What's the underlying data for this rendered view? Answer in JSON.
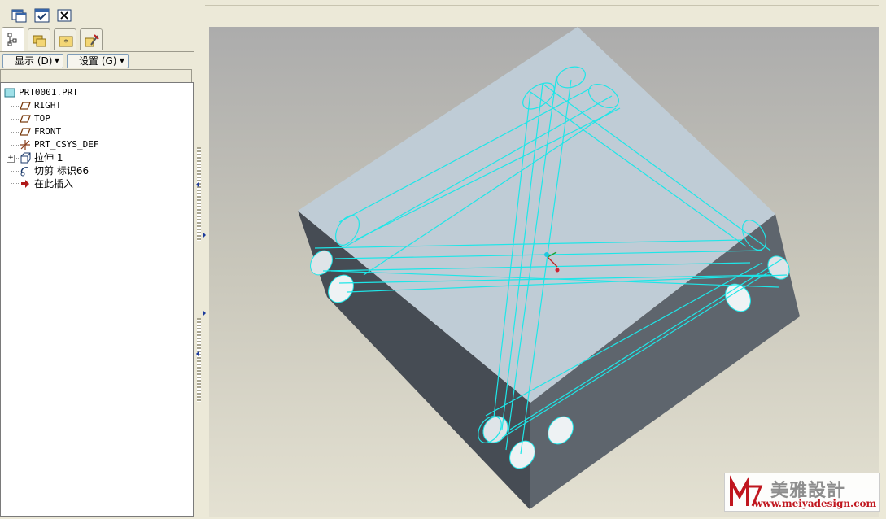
{
  "toolbar": {
    "buttons": [
      {
        "icon": "window-icon"
      },
      {
        "icon": "activate-window-icon"
      },
      {
        "icon": "close-window-icon"
      }
    ]
  },
  "tabs": [
    {
      "name": "model-tree-tab",
      "icon": "tree-icon",
      "active": true
    },
    {
      "name": "folder-browser-tab",
      "icon": "folders-icon",
      "active": false
    },
    {
      "name": "favorites-tab",
      "icon": "star-folder-icon",
      "active": false
    },
    {
      "name": "connections-tab",
      "icon": "tools-icon",
      "active": false
    }
  ],
  "dropdowns": {
    "display_label": "显示 (D)",
    "settings_label": "设置 (G)"
  },
  "tree": {
    "root": "PRT0001.PRT",
    "items": [
      {
        "label": "RIGHT",
        "icon": "datum-plane-icon"
      },
      {
        "label": "TOP",
        "icon": "datum-plane-icon"
      },
      {
        "label": "FRONT",
        "icon": "datum-plane-icon"
      },
      {
        "label": "PRT_CSYS_DEF",
        "icon": "coordinate-system-icon"
      },
      {
        "label": "拉伸 1",
        "icon": "extrude-icon",
        "expandable": true
      },
      {
        "label": "切剪 标识66",
        "icon": "cut-icon"
      },
      {
        "label": "在此插入",
        "icon": "insert-here-arrow-icon"
      }
    ]
  },
  "viewport": {
    "model": "block with crossing drilled holes",
    "edge_color": "#1ee6e8",
    "top_face_color": "#bfccd6",
    "side_face_color": "#4a5159",
    "background_top": "#b0b0b0",
    "background_bottom": "#e2dfd0"
  },
  "watermark": {
    "brand": "美雅設計",
    "url": "www.meiyadesign.com"
  }
}
